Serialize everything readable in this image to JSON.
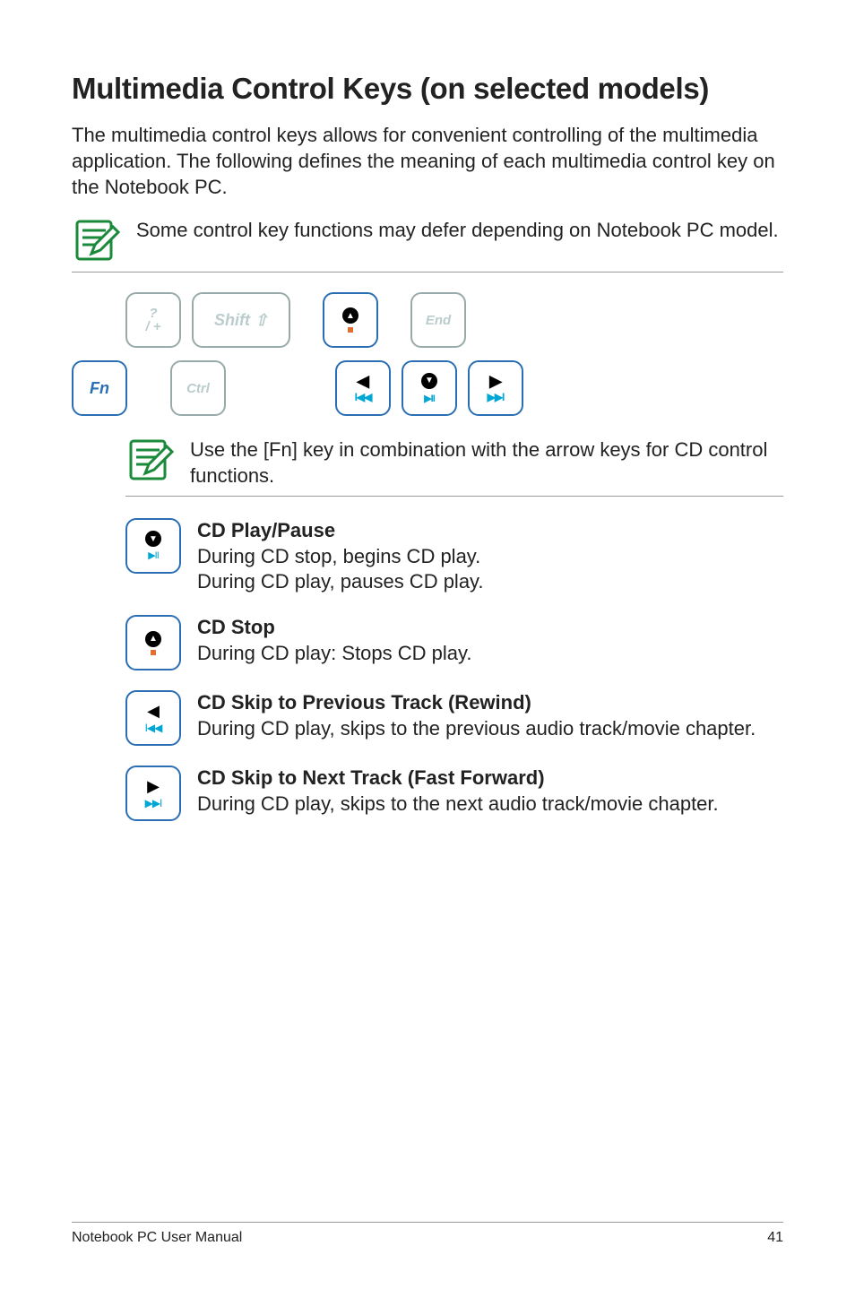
{
  "heading": "Multimedia Control Keys (on selected models)",
  "intro": "The multimedia control keys allows for convenient controlling of the multimedia application. The following defines the meaning of each multimedia control key on the Notebook PC.",
  "note1": "Some control key functions may defer depending on Notebook PC model.",
  "note2": "Use the [Fn] key in combination with the arrow keys for CD control functions.",
  "keys": {
    "fn": "Fn",
    "slash_top": "?",
    "slash_bot": "/    +",
    "shift": "Shift ⇧",
    "end": "End",
    "ctrl": "Ctrl"
  },
  "functions": [
    {
      "title": "CD Play/Pause",
      "lines": [
        "During CD stop, begins CD play.",
        "During CD play, pauses CD play."
      ]
    },
    {
      "title": "CD Stop",
      "lines": [
        "During CD play: Stops CD play."
      ]
    },
    {
      "title": "CD Skip to Previous Track (Rewind)",
      "lines": [
        "During CD play, skips to the previous audio track/movie chapter."
      ]
    },
    {
      "title": "CD Skip to Next Track (Fast Forward)",
      "lines": [
        "During CD play, skips to the next audio track/movie chapter."
      ]
    }
  ],
  "footer_left": "Notebook PC User Manual",
  "footer_right": "41"
}
